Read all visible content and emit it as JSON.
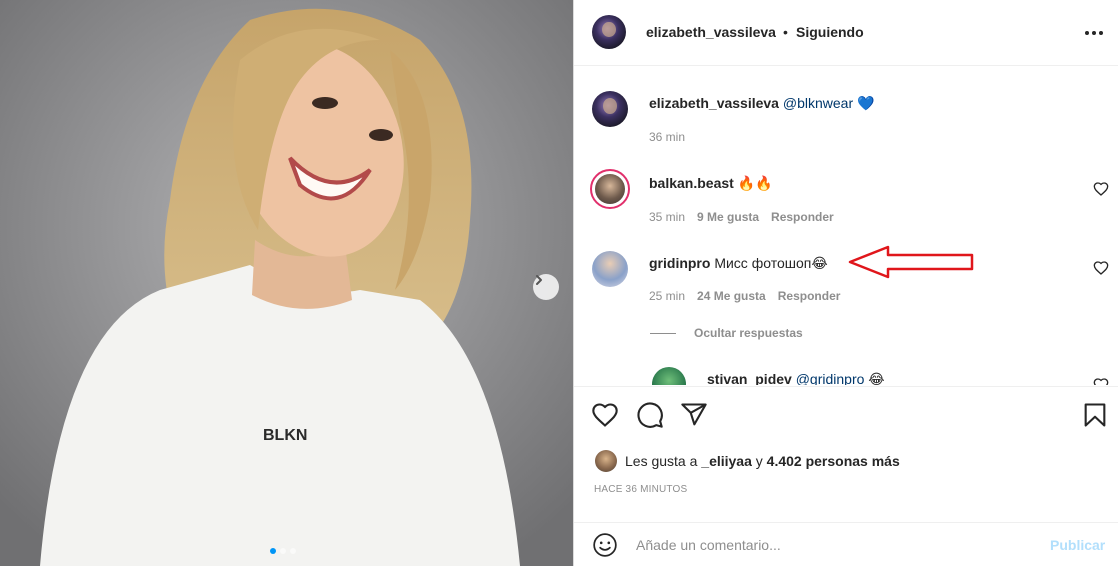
{
  "post": {
    "author": "elizabeth_vassileva",
    "separator": "•",
    "follow_status": "Siguiendo",
    "shirt_text": "BLKN"
  },
  "caption": {
    "username": "elizabeth_vassileva",
    "mention": "@blknwear",
    "emoji": "💙",
    "time": "36 min"
  },
  "comments": [
    {
      "username": "balkan.beast",
      "text": "🔥🔥",
      "time": "35 min",
      "likes": "9 Me gusta",
      "reply": "Responder"
    },
    {
      "username": "gridinpro",
      "text": "Мисс фотошоп😂",
      "time": "25 min",
      "likes": "24 Me gusta",
      "reply": "Responder"
    }
  ],
  "hide_replies": "Ocultar respuestas",
  "reply": {
    "username": "stivan_pidev",
    "mention": "@gridinpro",
    "emoji": "😂"
  },
  "likes_line": {
    "prefix": "Les gusta a",
    "user": "_eliiyaa",
    "conj": "y",
    "count": "4.402 personas más"
  },
  "time_ago": "HACE 36 MINUTOS",
  "add_comment": {
    "placeholder": "Añade un comentario...",
    "publish": "Publicar"
  },
  "carousel": {
    "total": 3,
    "active": 1
  },
  "colors": {
    "accent": "#0095f6",
    "publish_disabled": "#b2dffc",
    "annotation_arrow": "#e0161b"
  },
  "icons": [
    "more-options-icon",
    "heart-icon",
    "comment-icon",
    "share-icon",
    "bookmark-icon",
    "emoji-icon",
    "chevron-right-icon"
  ]
}
